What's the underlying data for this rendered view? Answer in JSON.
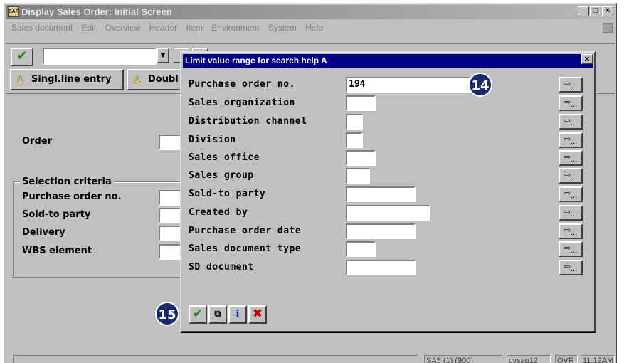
{
  "window": {
    "title": "Display Sales Order: Initial Screen",
    "app_icon": "sap-icon"
  },
  "menu": [
    "Sales document",
    "Edit",
    "Overview",
    "Header",
    "Item",
    "Environment",
    "System",
    "Help"
  ],
  "toolbar": {
    "ok_icon": "checkmark-icon",
    "command_value": ""
  },
  "app_toolbar": {
    "single_line_label": "Singl.line entry",
    "double_line_label": "Doubl"
  },
  "main": {
    "order_label": "Order",
    "group_title": "Selection criteria",
    "fields": [
      "Purchase order no.",
      "Sold-to party",
      "Delivery",
      "WBS element"
    ]
  },
  "dialog": {
    "title": "Limit value range for search help A",
    "rows": [
      {
        "label": "Purchase order no.",
        "value": "194"
      },
      {
        "label": "Sales organization",
        "value": ""
      },
      {
        "label": "Distribution channel",
        "value": ""
      },
      {
        "label": "Division",
        "value": ""
      },
      {
        "label": "Sales office",
        "value": ""
      },
      {
        "label": "Sales group",
        "value": ""
      },
      {
        "label": "Sold-to party",
        "value": ""
      },
      {
        "label": "Created by",
        "value": ""
      },
      {
        "label": "Purchase order date",
        "value": ""
      },
      {
        "label": "Sales document type",
        "value": ""
      },
      {
        "label": "SD document",
        "value": ""
      }
    ],
    "callout_14": "14",
    "callout_15": "15"
  },
  "status": {
    "system": "SA5 (1) (900)",
    "host": "cysap12",
    "mode": "OVR",
    "time": "11:12AM"
  }
}
